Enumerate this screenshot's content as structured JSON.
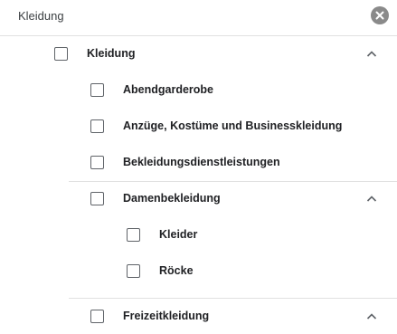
{
  "search": {
    "value": "Kleidung",
    "clear_icon": "close-circle-icon"
  },
  "tree": {
    "root": {
      "label": "Kleidung",
      "checked": false,
      "expanded": true
    },
    "items": [
      {
        "label": "Abendgarderobe",
        "checked": false
      },
      {
        "label": "Anzüge, Kostüme und Businesskleidung",
        "checked": false
      },
      {
        "label": "Bekleidungsdienstleistungen",
        "checked": false
      },
      {
        "label": "Damenbekleidung",
        "checked": false,
        "expanded": true,
        "children": [
          {
            "label": "Kleider",
            "checked": false
          },
          {
            "label": "Röcke",
            "checked": false
          }
        ]
      },
      {
        "label": "Freizeitkleidung",
        "checked": false,
        "expanded": true
      }
    ]
  },
  "colors": {
    "text": "#202124",
    "checkbox_border": "#5f6368",
    "divider": "#e0e0e0",
    "clear_icon_bg": "#8a8a8a"
  }
}
